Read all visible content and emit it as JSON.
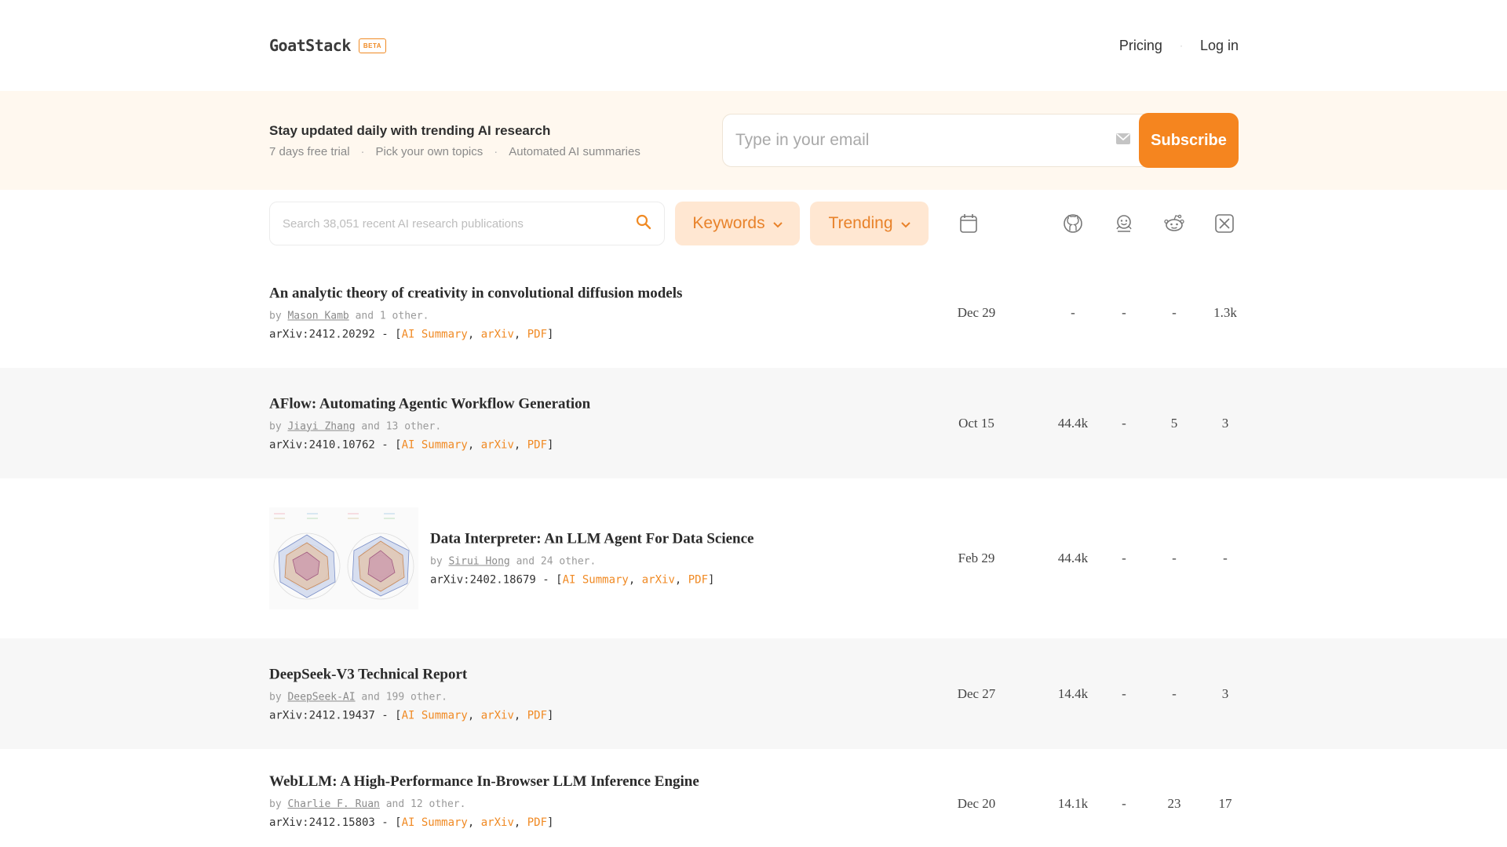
{
  "header": {
    "logo": "GoatStack",
    "badge": "BETA",
    "nav": {
      "pricing": "Pricing",
      "separator": "·",
      "login": "Log in"
    }
  },
  "banner": {
    "title": "Stay updated daily with trending AI research",
    "features": [
      "7 days free trial",
      "Pick your own topics",
      "Automated AI summaries"
    ],
    "separator": "·",
    "email_placeholder": "Type in your email",
    "subscribe_label": "Subscribe"
  },
  "toolbar": {
    "search_placeholder": "Search 38,051 recent AI research publications",
    "keywords_label": "Keywords",
    "sort_label": "Trending",
    "column_icons": [
      "calendar-icon",
      "github-icon",
      "huggingface-icon",
      "reddit-icon",
      "x-icon"
    ]
  },
  "papers": [
    {
      "title": "An analytic theory of creativity in convolutional diffusion models",
      "by": "by",
      "author": "Mason Kamb",
      "others": "and 1 other.",
      "arxiv_id": "arXiv:2412.20292 - [",
      "links": [
        "AI Summary",
        "arXiv",
        "PDF"
      ],
      "close": "]",
      "date": "Dec 29",
      "github": "-",
      "huggingface": "-",
      "reddit": "-",
      "x": "1.3k"
    },
    {
      "title": "AFlow: Automating Agentic Workflow Generation",
      "by": "by",
      "author": "Jiayi Zhang",
      "others": "and 13 other.",
      "arxiv_id": "arXiv:2410.10762 - [",
      "links": [
        "AI Summary",
        "arXiv",
        "PDF"
      ],
      "close": "]",
      "date": "Oct 15",
      "github": "44.4k",
      "huggingface": "-",
      "reddit": "5",
      "x": "3"
    },
    {
      "title": "Data Interpreter: An LLM Agent For Data Science",
      "by": "by",
      "author": "Sirui Hong",
      "others": "and 24 other.",
      "arxiv_id": "arXiv:2402.18679 - [",
      "links": [
        "AI Summary",
        "arXiv",
        "PDF"
      ],
      "close": "]",
      "date": "Feb 29",
      "github": "44.4k",
      "huggingface": "-",
      "reddit": "-",
      "x": "-"
    },
    {
      "title": "DeepSeek-V3 Technical Report",
      "by": "by",
      "author": "DeepSeek-AI",
      "others": "and 199 other.",
      "arxiv_id": "arXiv:2412.19437 - [",
      "links": [
        "AI Summary",
        "arXiv",
        "PDF"
      ],
      "close": "]",
      "date": "Dec 27",
      "github": "14.4k",
      "huggingface": "-",
      "reddit": "-",
      "x": "3"
    },
    {
      "title": "WebLLM: A High-Performance In-Browser LLM Inference Engine",
      "by": "by",
      "author": "Charlie F. Ruan",
      "others": "and 12 other.",
      "arxiv_id": "arXiv:2412.15803 - [",
      "links": [
        "AI Summary",
        "arXiv",
        "PDF"
      ],
      "close": "]",
      "date": "Dec 20",
      "github": "14.1k",
      "huggingface": "-",
      "reddit": "23",
      "x": "17"
    }
  ],
  "colors": {
    "accent": "#f5851f",
    "banner_bg": "#fff8ef",
    "pill_bg": "#ffe7d2"
  }
}
